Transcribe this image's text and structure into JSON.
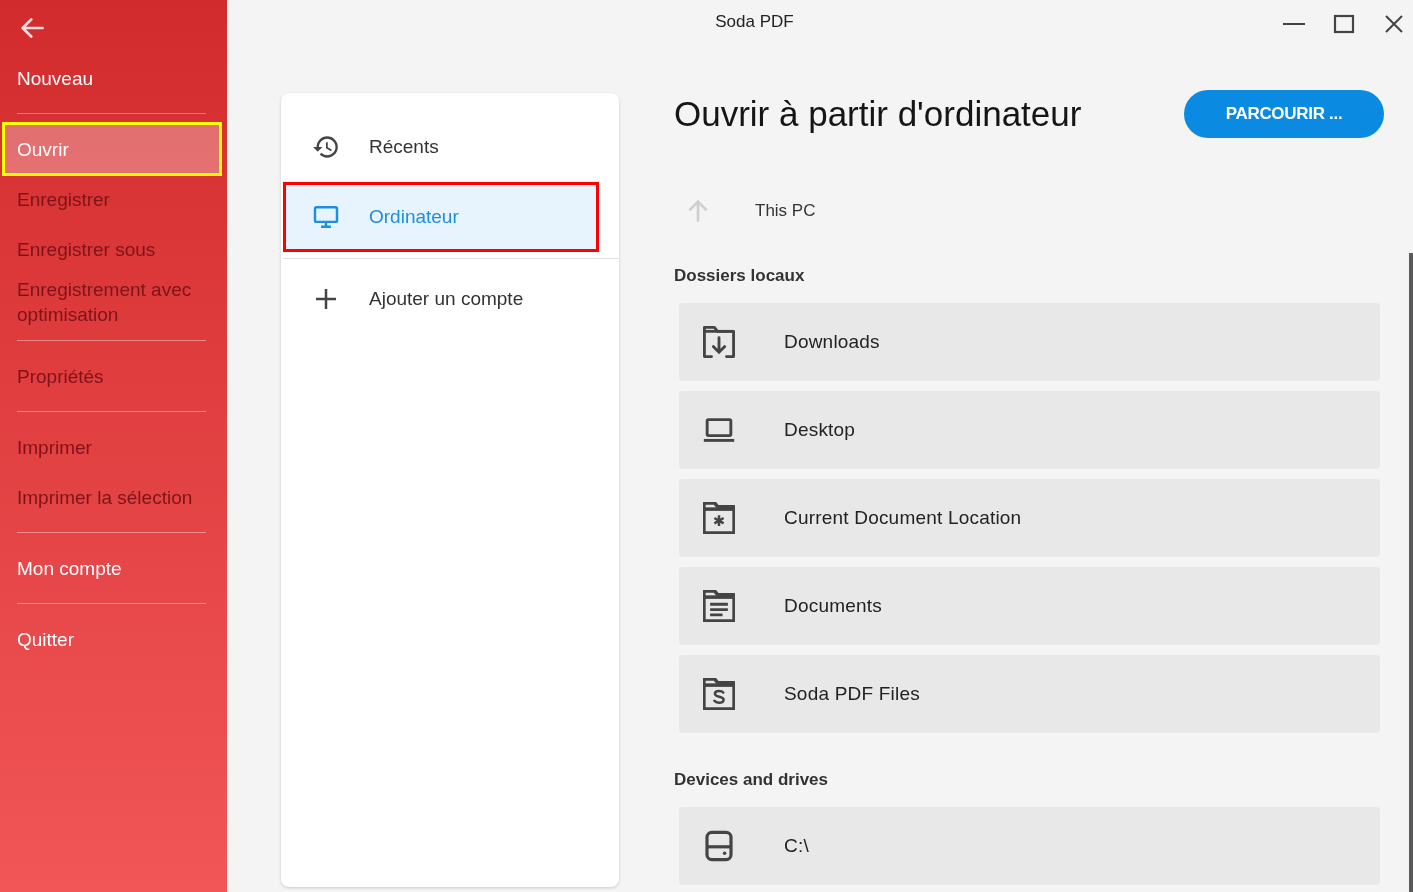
{
  "window": {
    "title": "Soda PDF"
  },
  "sidebar": {
    "groups": [
      {
        "items": [
          {
            "label": "Nouveau",
            "selected": false,
            "disabled": false,
            "annotated": false
          }
        ]
      },
      {
        "items": [
          {
            "label": "Ouvrir",
            "selected": true,
            "disabled": false,
            "annotated": true
          },
          {
            "label": "Enregistrer",
            "selected": false,
            "disabled": true,
            "annotated": false
          },
          {
            "label": "Enregistrer sous",
            "selected": false,
            "disabled": true,
            "annotated": false
          },
          {
            "label": "Enregistrement avec optimisation",
            "selected": false,
            "disabled": true,
            "annotated": false
          }
        ]
      },
      {
        "items": [
          {
            "label": "Propriétés",
            "selected": false,
            "disabled": true,
            "annotated": false
          }
        ]
      },
      {
        "items": [
          {
            "label": "Imprimer",
            "selected": false,
            "disabled": true,
            "annotated": false
          },
          {
            "label": "Imprimer la sélection",
            "selected": false,
            "disabled": true,
            "annotated": false
          }
        ]
      },
      {
        "items": [
          {
            "label": "Mon compte",
            "selected": false,
            "disabled": false,
            "annotated": false
          }
        ]
      },
      {
        "items": [
          {
            "label": "Quitter",
            "selected": false,
            "disabled": false,
            "annotated": false
          }
        ]
      }
    ]
  },
  "sources": {
    "items": [
      {
        "kind": "recent",
        "label": "Récents",
        "selected": false,
        "annotated": false
      },
      {
        "kind": "computer",
        "label": "Ordinateur",
        "selected": true,
        "annotated": true
      }
    ],
    "add_account": {
      "label": "Ajouter un compte"
    }
  },
  "content": {
    "title": "Ouvrir à partir d'ordinateur",
    "browse_button": "PARCOURIR ...",
    "breadcrumb": {
      "label": "This PC",
      "up_disabled": true
    },
    "sections": [
      {
        "heading": "Dossiers locaux",
        "items": [
          {
            "kind": "downloads",
            "label": "Downloads"
          },
          {
            "kind": "desktop",
            "label": "Desktop"
          },
          {
            "kind": "current",
            "label": "Current Document Location"
          },
          {
            "kind": "documents",
            "label": "Documents"
          },
          {
            "kind": "soda",
            "label": "Soda PDF Files"
          }
        ]
      },
      {
        "heading": "Devices and drives",
        "items": [
          {
            "kind": "drive",
            "label": "C:\\"
          }
        ]
      }
    ]
  }
}
